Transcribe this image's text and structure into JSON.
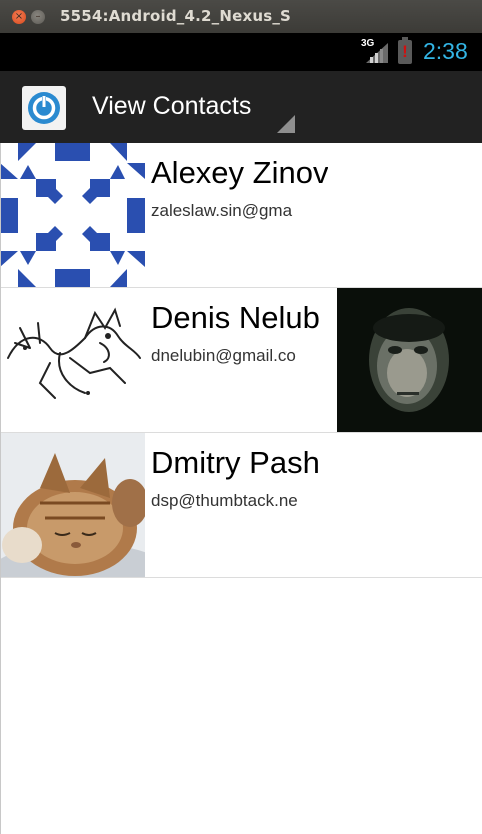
{
  "window": {
    "title": "5554:Android_4.2_Nexus_S"
  },
  "status_bar": {
    "network": "3G",
    "battery_alert": "!",
    "time": "2:38",
    "accent_color": "#33b5e5"
  },
  "action_bar": {
    "title": "View Contacts",
    "app_icon": "power-icon"
  },
  "contacts": [
    {
      "name": "Alexey Zinov",
      "email": "zaleslaw.sin@gma",
      "avatar": "identicon",
      "has_photo": false
    },
    {
      "name": "Denis Nelub",
      "email": "dnelubin@gmail.co",
      "avatar": "sketch-drawing",
      "has_photo": true
    },
    {
      "name": "Dmitry Pash",
      "email": "dsp@thumbtack.ne",
      "avatar": "sleeping-kitten",
      "has_photo": false
    }
  ]
}
